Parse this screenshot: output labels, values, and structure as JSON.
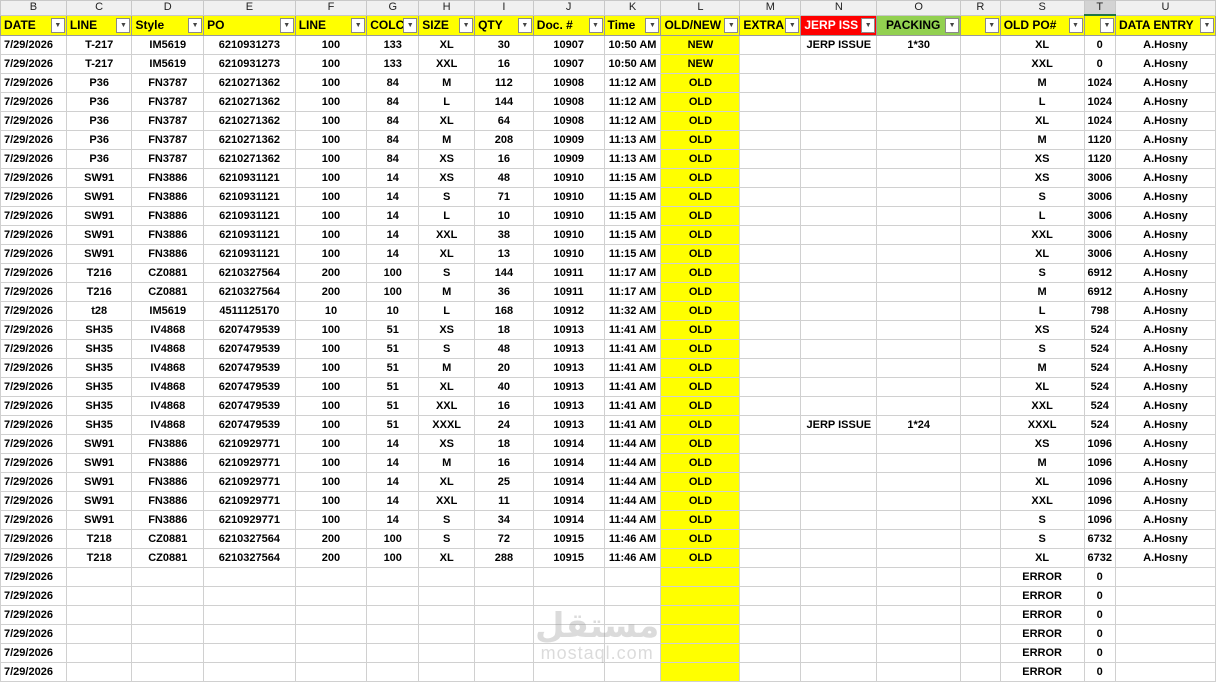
{
  "column_letters": [
    "B",
    "C",
    "D",
    "E",
    "F",
    "G",
    "H",
    "I",
    "J",
    "K",
    "L",
    "M",
    "N",
    "O",
    "R",
    "S",
    "T",
    "U"
  ],
  "selected_column": "T",
  "headers": [
    {
      "label": "DATE",
      "style": "yellow"
    },
    {
      "label": "LINE",
      "style": "yellow"
    },
    {
      "label": "Style",
      "style": "yellow"
    },
    {
      "label": "PO",
      "style": "yellow"
    },
    {
      "label": "LINE",
      "style": "yellow"
    },
    {
      "label": "COLC",
      "style": "yellow"
    },
    {
      "label": "SIZE",
      "style": "yellow"
    },
    {
      "label": "QTY",
      "style": "yellow"
    },
    {
      "label": "Doc. #",
      "style": "yellow"
    },
    {
      "label": "Time",
      "style": "yellow"
    },
    {
      "label": "OLD/NEW",
      "style": "yellow"
    },
    {
      "label": "EXTRA",
      "style": "yellow"
    },
    {
      "label": "JERP ISS",
      "style": "red"
    },
    {
      "label": "PACKING",
      "style": "green"
    },
    {
      "label": "",
      "style": "yellow"
    },
    {
      "label": "OLD PO#",
      "style": "yellow"
    },
    {
      "label": "",
      "style": "yellow"
    },
    {
      "label": "DATA ENTRY",
      "style": "yellow"
    }
  ],
  "rows": [
    [
      "7/29/2026",
      "T-217",
      "IM5619",
      "6210931273",
      "100",
      "133",
      "XL",
      "30",
      "10907",
      "10:50 AM",
      "NEW",
      "",
      "JERP ISSUE",
      "1*30",
      "",
      "XL",
      "0",
      "A.Hosny"
    ],
    [
      "7/29/2026",
      "T-217",
      "IM5619",
      "6210931273",
      "100",
      "133",
      "XXL",
      "16",
      "10907",
      "10:50 AM",
      "NEW",
      "",
      "",
      "",
      "",
      "XXL",
      "0",
      "A.Hosny"
    ],
    [
      "7/29/2026",
      "P36",
      "FN3787",
      "6210271362",
      "100",
      "84",
      "M",
      "112",
      "10908",
      "11:12 AM",
      "OLD",
      "",
      "",
      "",
      "",
      "M",
      "1024",
      "A.Hosny"
    ],
    [
      "7/29/2026",
      "P36",
      "FN3787",
      "6210271362",
      "100",
      "84",
      "L",
      "144",
      "10908",
      "11:12 AM",
      "OLD",
      "",
      "",
      "",
      "",
      "L",
      "1024",
      "A.Hosny"
    ],
    [
      "7/29/2026",
      "P36",
      "FN3787",
      "6210271362",
      "100",
      "84",
      "XL",
      "64",
      "10908",
      "11:12 AM",
      "OLD",
      "",
      "",
      "",
      "",
      "XL",
      "1024",
      "A.Hosny"
    ],
    [
      "7/29/2026",
      "P36",
      "FN3787",
      "6210271362",
      "100",
      "84",
      "M",
      "208",
      "10909",
      "11:13 AM",
      "OLD",
      "",
      "",
      "",
      "",
      "M",
      "1120",
      "A.Hosny"
    ],
    [
      "7/29/2026",
      "P36",
      "FN3787",
      "6210271362",
      "100",
      "84",
      "XS",
      "16",
      "10909",
      "11:13 AM",
      "OLD",
      "",
      "",
      "",
      "",
      "XS",
      "1120",
      "A.Hosny"
    ],
    [
      "7/29/2026",
      "SW91",
      "FN3886",
      "6210931121",
      "100",
      "14",
      "XS",
      "48",
      "10910",
      "11:15 AM",
      "OLD",
      "",
      "",
      "",
      "",
      "XS",
      "3006",
      "A.Hosny"
    ],
    [
      "7/29/2026",
      "SW91",
      "FN3886",
      "6210931121",
      "100",
      "14",
      "S",
      "71",
      "10910",
      "11:15 AM",
      "OLD",
      "",
      "",
      "",
      "",
      "S",
      "3006",
      "A.Hosny"
    ],
    [
      "7/29/2026",
      "SW91",
      "FN3886",
      "6210931121",
      "100",
      "14",
      "L",
      "10",
      "10910",
      "11:15 AM",
      "OLD",
      "",
      "",
      "",
      "",
      "L",
      "3006",
      "A.Hosny"
    ],
    [
      "7/29/2026",
      "SW91",
      "FN3886",
      "6210931121",
      "100",
      "14",
      "XXL",
      "38",
      "10910",
      "11:15 AM",
      "OLD",
      "",
      "",
      "",
      "",
      "XXL",
      "3006",
      "A.Hosny"
    ],
    [
      "7/29/2026",
      "SW91",
      "FN3886",
      "6210931121",
      "100",
      "14",
      "XL",
      "13",
      "10910",
      "11:15 AM",
      "OLD",
      "",
      "",
      "",
      "",
      "XL",
      "3006",
      "A.Hosny"
    ],
    [
      "7/29/2026",
      "T216",
      "CZ0881",
      "6210327564",
      "200",
      "100",
      "S",
      "144",
      "10911",
      "11:17 AM",
      "OLD",
      "",
      "",
      "",
      "",
      "S",
      "6912",
      "A.Hosny"
    ],
    [
      "7/29/2026",
      "T216",
      "CZ0881",
      "6210327564",
      "200",
      "100",
      "M",
      "36",
      "10911",
      "11:17 AM",
      "OLD",
      "",
      "",
      "",
      "",
      "M",
      "6912",
      "A.Hosny"
    ],
    [
      "7/29/2026",
      "t28",
      "IM5619",
      "4511125170",
      "10",
      "10",
      "L",
      "168",
      "10912",
      "11:32 AM",
      "OLD",
      "",
      "",
      "",
      "",
      "L",
      "798",
      "A.Hosny"
    ],
    [
      "7/29/2026",
      "SH35",
      "IV4868",
      "6207479539",
      "100",
      "51",
      "XS",
      "18",
      "10913",
      "11:41 AM",
      "OLD",
      "",
      "",
      "",
      "",
      "XS",
      "524",
      "A.Hosny"
    ],
    [
      "7/29/2026",
      "SH35",
      "IV4868",
      "6207479539",
      "100",
      "51",
      "S",
      "48",
      "10913",
      "11:41 AM",
      "OLD",
      "",
      "",
      "",
      "",
      "S",
      "524",
      "A.Hosny"
    ],
    [
      "7/29/2026",
      "SH35",
      "IV4868",
      "6207479539",
      "100",
      "51",
      "M",
      "20",
      "10913",
      "11:41 AM",
      "OLD",
      "",
      "",
      "",
      "",
      "M",
      "524",
      "A.Hosny"
    ],
    [
      "7/29/2026",
      "SH35",
      "IV4868",
      "6207479539",
      "100",
      "51",
      "XL",
      "40",
      "10913",
      "11:41 AM",
      "OLD",
      "",
      "",
      "",
      "",
      "XL",
      "524",
      "A.Hosny"
    ],
    [
      "7/29/2026",
      "SH35",
      "IV4868",
      "6207479539",
      "100",
      "51",
      "XXL",
      "16",
      "10913",
      "11:41 AM",
      "OLD",
      "",
      "",
      "",
      "",
      "XXL",
      "524",
      "A.Hosny"
    ],
    [
      "7/29/2026",
      "SH35",
      "IV4868",
      "6207479539",
      "100",
      "51",
      "XXXL",
      "24",
      "10913",
      "11:41 AM",
      "OLD",
      "",
      "JERP ISSUE",
      "1*24",
      "",
      "XXXL",
      "524",
      "A.Hosny"
    ],
    [
      "7/29/2026",
      "SW91",
      "FN3886",
      "6210929771",
      "100",
      "14",
      "XS",
      "18",
      "10914",
      "11:44 AM",
      "OLD",
      "",
      "",
      "",
      "",
      "XS",
      "1096",
      "A.Hosny"
    ],
    [
      "7/29/2026",
      "SW91",
      "FN3886",
      "6210929771",
      "100",
      "14",
      "M",
      "16",
      "10914",
      "11:44 AM",
      "OLD",
      "",
      "",
      "",
      "",
      "M",
      "1096",
      "A.Hosny"
    ],
    [
      "7/29/2026",
      "SW91",
      "FN3886",
      "6210929771",
      "100",
      "14",
      "XL",
      "25",
      "10914",
      "11:44 AM",
      "OLD",
      "",
      "",
      "",
      "",
      "XL",
      "1096",
      "A.Hosny"
    ],
    [
      "7/29/2026",
      "SW91",
      "FN3886",
      "6210929771",
      "100",
      "14",
      "XXL",
      "11",
      "10914",
      "11:44 AM",
      "OLD",
      "",
      "",
      "",
      "",
      "XXL",
      "1096",
      "A.Hosny"
    ],
    [
      "7/29/2026",
      "SW91",
      "FN3886",
      "6210929771",
      "100",
      "14",
      "S",
      "34",
      "10914",
      "11:44 AM",
      "OLD",
      "",
      "",
      "",
      "",
      "S",
      "1096",
      "A.Hosny"
    ],
    [
      "7/29/2026",
      "T218",
      "CZ0881",
      "6210327564",
      "200",
      "100",
      "S",
      "72",
      "10915",
      "11:46 AM",
      "OLD",
      "",
      "",
      "",
      "",
      "S",
      "6732",
      "A.Hosny"
    ],
    [
      "7/29/2026",
      "T218",
      "CZ0881",
      "6210327564",
      "200",
      "100",
      "XL",
      "288",
      "10915",
      "11:46 AM",
      "OLD",
      "",
      "",
      "",
      "",
      "XL",
      "6732",
      "A.Hosny"
    ],
    [
      "7/29/2026",
      "",
      "",
      "",
      "",
      "",
      "",
      "",
      "",
      "",
      "",
      "",
      "",
      "",
      "",
      "ERROR",
      "0",
      ""
    ],
    [
      "7/29/2026",
      "",
      "",
      "",
      "",
      "",
      "",
      "",
      "",
      "",
      "",
      "",
      "",
      "",
      "",
      "ERROR",
      "0",
      ""
    ],
    [
      "7/29/2026",
      "",
      "",
      "",
      "",
      "",
      "",
      "",
      "",
      "",
      "",
      "",
      "",
      "",
      "",
      "ERROR",
      "0",
      ""
    ],
    [
      "7/29/2026",
      "",
      "",
      "",
      "",
      "",
      "",
      "",
      "",
      "",
      "",
      "",
      "",
      "",
      "",
      "ERROR",
      "0",
      ""
    ],
    [
      "7/29/2026",
      "",
      "",
      "",
      "",
      "",
      "",
      "",
      "",
      "",
      "",
      "",
      "",
      "",
      "",
      "ERROR",
      "0",
      ""
    ],
    [
      "7/29/2026",
      "",
      "",
      "",
      "",
      "",
      "",
      "",
      "",
      "",
      "",
      "",
      "",
      "",
      "",
      "ERROR",
      "0",
      ""
    ]
  ],
  "watermark": {
    "arabic": "مستقل",
    "latin": "mostaql.com"
  }
}
